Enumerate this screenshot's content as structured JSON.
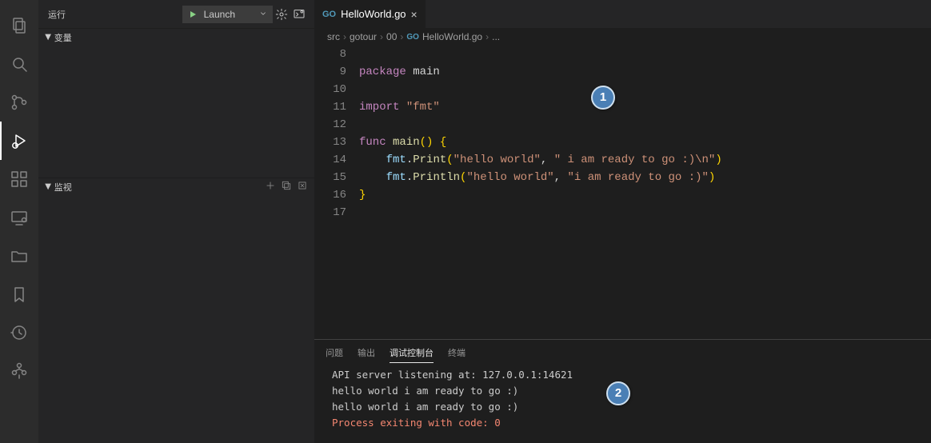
{
  "activity": {
    "icons": [
      "files",
      "search",
      "scm",
      "debug",
      "extensions",
      "remote",
      "folder",
      "bookmark",
      "history",
      "tree"
    ]
  },
  "debugBar": {
    "runLabel": "运行",
    "launchName": "Launch"
  },
  "sections": {
    "vars": "变量",
    "watch": "监视"
  },
  "tab": {
    "go": "GO",
    "fileName": "HelloWorld.go",
    "close": "×"
  },
  "breadcrumbs": [
    "src",
    "gotour",
    "00",
    "HelloWorld.go",
    "..."
  ],
  "callouts": {
    "one": "1",
    "two": "2"
  },
  "code": {
    "lineNumbers": [
      "8",
      "9",
      "10",
      "11",
      "12",
      "13",
      "14",
      "15",
      "16",
      "17"
    ],
    "l9_package": "package",
    "l9_main": "main",
    "l11_import": "import",
    "l11_str": "\"fmt\"",
    "l13_func": "func",
    "l13_main": "main",
    "l13_paren": "()",
    "l13_brace": " {",
    "l14_indent": "    ",
    "l14_pkg": "fmt",
    "l14_dot": ".",
    "l14_fn": "Print",
    "l14_open": "(",
    "l14_s1": "\"hello world\"",
    "l14_comma": ", ",
    "l14_s2": "\" i am ready to go :)\\n\"",
    "l14_close": ")",
    "l15_indent": "    ",
    "l15_pkg": "fmt",
    "l15_dot": ".",
    "l15_fn": "Println",
    "l15_open": "(",
    "l15_s1": "\"hello world\"",
    "l15_comma": ", ",
    "l15_s2": "\"i am ready to go :)\"",
    "l15_close": ")",
    "l16_brace": "}"
  },
  "panel": {
    "tabs": {
      "problems": "问题",
      "output": "输出",
      "debugConsole": "调试控制台",
      "terminal": "终端"
    },
    "lines": {
      "l1": "API server listening at: 127.0.0.1:14621",
      "l2": "hello world i am ready to go :)",
      "l3": "hello world i am ready to go :)",
      "exit": "Process exiting with code: 0"
    }
  }
}
